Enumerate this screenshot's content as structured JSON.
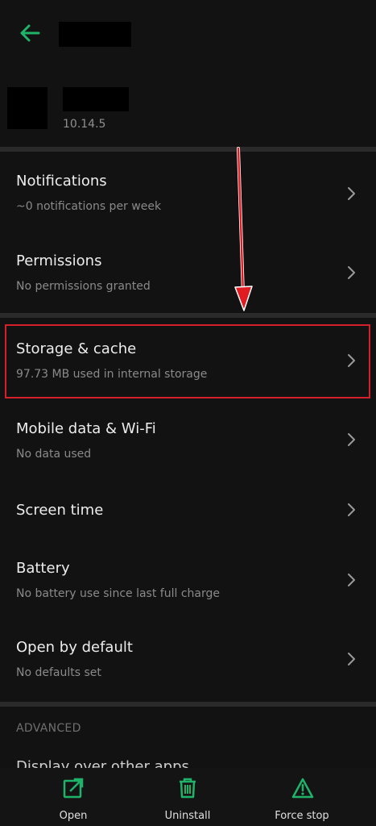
{
  "app": {
    "version": "10.14.5"
  },
  "settings": {
    "notifications": {
      "title": "Notifications",
      "sub": "~0 notifications per week"
    },
    "permissions": {
      "title": "Permissions",
      "sub": "No permissions granted"
    },
    "storage": {
      "title": "Storage & cache",
      "sub": "97.73 MB used in internal storage"
    },
    "mobile_data": {
      "title": "Mobile data & Wi-Fi",
      "sub": "No data used"
    },
    "screen_time": {
      "title": "Screen time"
    },
    "battery": {
      "title": "Battery",
      "sub": "No battery use since last full charge"
    },
    "open_default": {
      "title": "Open by default",
      "sub": "No defaults set"
    },
    "advanced_label": "ADVANCED",
    "cutoff_item": "Display over other apps"
  },
  "bottom_actions": {
    "open": "Open",
    "uninstall": "Uninstall",
    "force_stop": "Force stop"
  },
  "colors": {
    "accent": "#1fb36a",
    "highlight": "#d4202a",
    "background": "#121212"
  }
}
